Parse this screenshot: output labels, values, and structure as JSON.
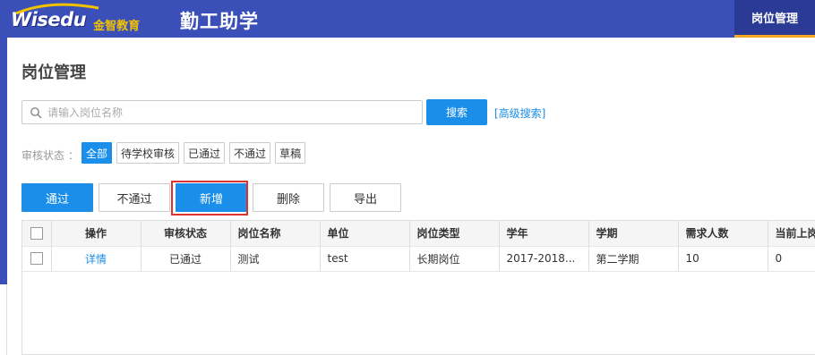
{
  "header": {
    "logo_text": "Wisedu",
    "logo_subtitle": "金智教育",
    "app_title": "勤工助学",
    "active_tab": "岗位管理"
  },
  "page": {
    "title": "岗位管理"
  },
  "search": {
    "placeholder": "请输入岗位名称",
    "button_label": "搜索",
    "advanced_label": "[高级搜索]"
  },
  "filter": {
    "label": "审核状态 ：",
    "tags": [
      "全部",
      "待学校审核",
      "已通过",
      "不通过",
      "草稿"
    ],
    "active_index": 0
  },
  "toolbar": {
    "buttons": [
      "通过",
      "不通过",
      "新增",
      "删除",
      "导出"
    ],
    "highlighted_button": "新增"
  },
  "table": {
    "columns": [
      "操作",
      "审核状态",
      "岗位名称",
      "单位",
      "岗位类型",
      "学年",
      "学期",
      "需求人数",
      "当前上岗"
    ],
    "rows": [
      [
        "详情",
        "已通过",
        "测试",
        "test",
        "长期岗位",
        "2017-2018...",
        "第二学期",
        "10",
        "0"
      ]
    ]
  },
  "colors": {
    "header_bg": "#3b4fb8",
    "accent": "#1a8ee8",
    "highlight_border": "#e03030",
    "tab_underline": "#f5a623"
  }
}
